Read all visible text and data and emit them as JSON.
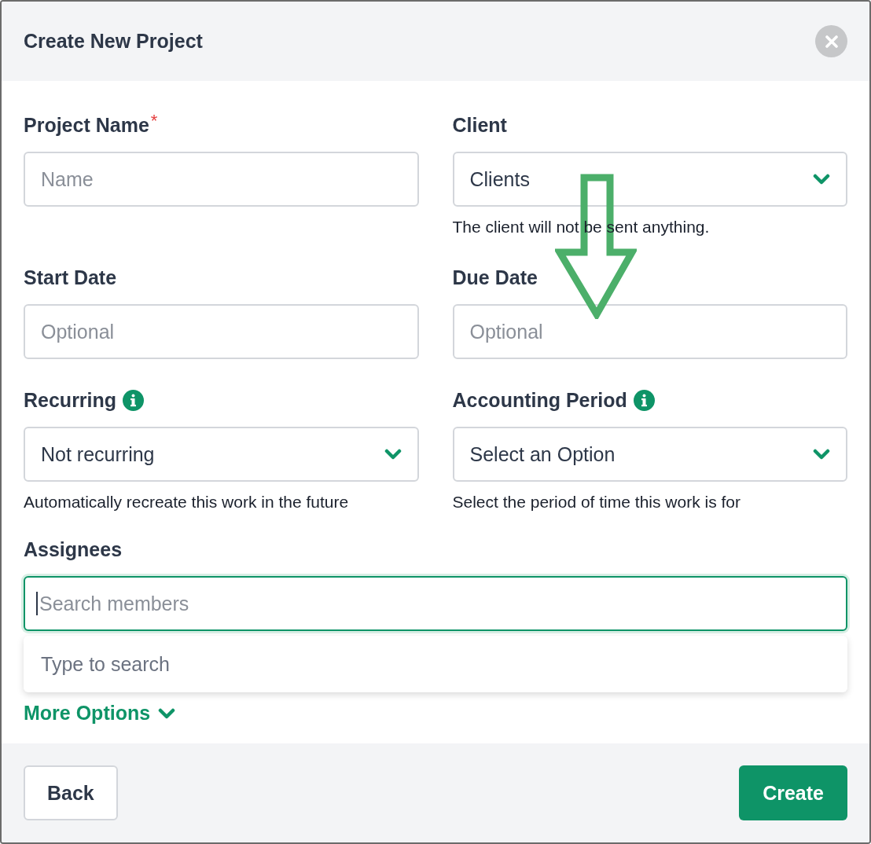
{
  "dialog": {
    "title": "Create New Project"
  },
  "fields": [
    {
      "kind": "text",
      "label": "Project Name",
      "required_mark": "*",
      "info": false,
      "placeholder": "Name"
    },
    {
      "kind": "select",
      "label": "Client",
      "info": false,
      "value": "Clients",
      "hint": "The client will not be sent anything."
    },
    {
      "kind": "text",
      "label": "Start Date",
      "info": false,
      "placeholder": "Optional"
    },
    {
      "kind": "text",
      "label": "Due Date",
      "info": false,
      "placeholder": "Optional"
    },
    {
      "kind": "select",
      "label": "Recurring",
      "info": true,
      "value": "Not recurring",
      "hint": "Automatically recreate this work in the future"
    },
    {
      "kind": "select",
      "label": "Accounting Period",
      "info": true,
      "value": "Select an Option",
      "hint": "Select the period of time this work is for"
    }
  ],
  "assignees": {
    "label": "Assignees",
    "placeholder": "Search members",
    "focused": true,
    "dropdown": [
      "Type to search"
    ]
  },
  "more_options": {
    "label": "More Options",
    "expanded": false
  },
  "buttons": [
    {
      "kind": "secondary",
      "label": "Back"
    },
    {
      "kind": "primary",
      "label": "Create"
    }
  ]
}
